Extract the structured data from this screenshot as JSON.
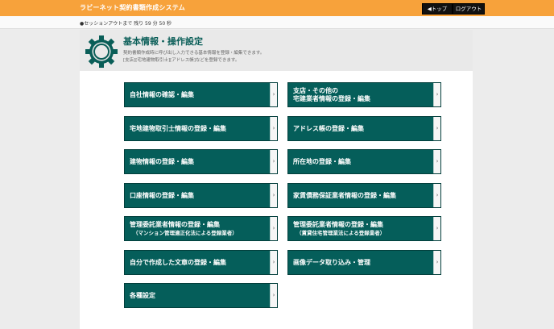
{
  "app": {
    "title": "ラビーネット契約書類作成システム",
    "top_button": "◀トップ",
    "logout_button": "ログアウト"
  },
  "session": {
    "text": "●セッションアウトまで  残り 59 分 50 秒"
  },
  "page": {
    "title": "基本情報・操作設定",
    "desc1": "契約書類作成時に呼び出し入力できる基本情報を登録・編集できます。",
    "desc2": "[支店][宅地建物取引士][アドレス帳]などを登録できます。",
    "icon": "gear-icon"
  },
  "menu": {
    "arrow": "›",
    "items": [
      {
        "label": "自社情報の確認・編集",
        "sub": ""
      },
      {
        "label": "支店・その他の",
        "sub": "宅建業者情報の登録・編集"
      },
      {
        "label": "宅地建物取引士情報の登録・編集",
        "sub": ""
      },
      {
        "label": "アドレス帳の登録・編集",
        "sub": ""
      },
      {
        "label": "建物情報の登録・編集",
        "sub": ""
      },
      {
        "label": "所在地の登録・編集",
        "sub": ""
      },
      {
        "label": "口座情報の登録・編集",
        "sub": ""
      },
      {
        "label": "家賃債務保証業者情報の登録・編集",
        "sub": ""
      },
      {
        "label": "管理委託業者情報の登録・編集",
        "sub": "（マンション管理適正化法による登録業者）"
      },
      {
        "label": "管理委託業者情報の登録・編集",
        "sub": "（賃貸住宅管理業法による登録業者）"
      },
      {
        "label": "自分で作成した文章の登録・編集",
        "sub": ""
      },
      {
        "label": "画像データ取り込み・管理",
        "sub": ""
      },
      {
        "label": "各種設定",
        "sub": ""
      }
    ]
  },
  "colors": {
    "topbar": "#f7a23b",
    "button_bg": "#055e5a",
    "title_text": "#0a5e58"
  }
}
